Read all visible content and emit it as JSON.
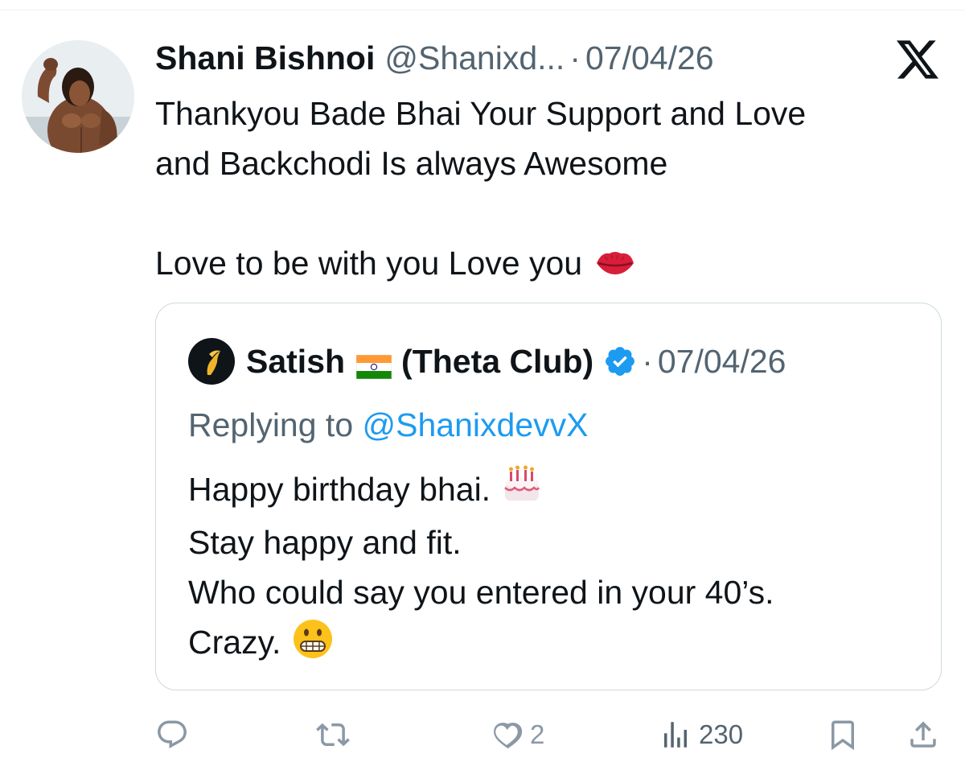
{
  "post": {
    "author_name": "Shani Bishnoi",
    "author_handle": "@Shanixd...",
    "dot": "·",
    "date": "07/04/26",
    "text_lines": [
      "Thankyou Bade Bhai Your Support and Love",
      "and Backchodi Is always Awesome",
      "Love to be with you Love you"
    ],
    "emoji": "kiss-lips"
  },
  "quote": {
    "author_name": "Satish",
    "org": "(Theta Club)",
    "flag": "india-flag",
    "verified": true,
    "dot": "·",
    "date": "07/04/26",
    "replying_label": "Replying to",
    "replying_handle": "@ShanixdevvX",
    "lines": [
      "Happy birthday bhai.",
      "Stay happy and fit.",
      "Who could say you entered in your 40’s.",
      "Crazy."
    ]
  },
  "actions": {
    "reply_count": "",
    "repost_count": "",
    "like_count": "2",
    "views_count": "230"
  },
  "colors": {
    "text": "#0f1419",
    "secondary": "#536471",
    "link": "#1d9bf0",
    "verified": "#1d9bf0",
    "action_icon": "#8b98a5",
    "border": "#cfd9de"
  },
  "icons": [
    "x-logo-icon",
    "reply-icon",
    "repost-icon",
    "like-icon",
    "views-icon",
    "bookmark-icon",
    "share-icon",
    "verified-badge-icon",
    "birthday-cake-emoji",
    "grimacing-face-emoji",
    "kiss-lips-emoji"
  ]
}
